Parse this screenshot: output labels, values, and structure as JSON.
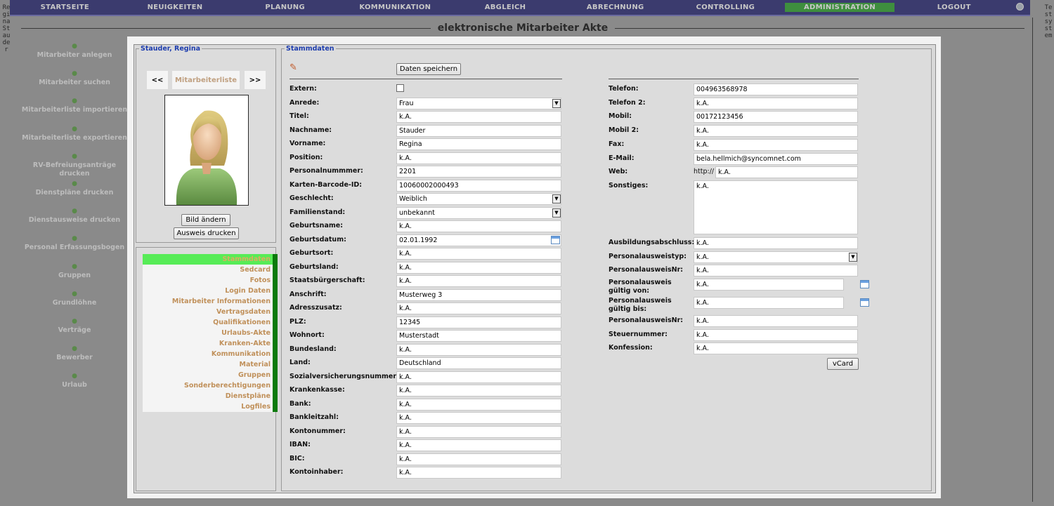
{
  "nav": {
    "items": [
      "STARTSEITE",
      "NEUIGKEITEN",
      "PLANUNG",
      "KOMMUNIKATION",
      "ABGLEICH",
      "ABRECHNUNG",
      "CONTROLLING",
      "ADMINISTRATION",
      "LOGOUT"
    ],
    "active": "ADMINISTRATION",
    "user_icon": "user-icon"
  },
  "side_left_text": "Regina Stauder",
  "side_right_text": "Testsystem",
  "page_title": "elektronische Mitarbeiter Akte",
  "left_menu": [
    {
      "label": "Mitarbeiter anlegen",
      "icon": "user-add-icon"
    },
    {
      "label": "Mitarbeiter suchen",
      "icon": "user-search-icon"
    },
    {
      "label": "Mitarbeiterliste importieren",
      "icon": "import-icon"
    },
    {
      "label": "Mitarbeiterliste exportieren",
      "icon": "export-icon"
    },
    {
      "label": "RV-Befreiungsanträge drucken",
      "icon": "pdf-icon"
    },
    {
      "label": "Dienstpläne drucken",
      "icon": "user-print-icon"
    },
    {
      "label": "Dienstausweise drucken",
      "icon": "id-card-icon"
    },
    {
      "label": "Personal Erfassungsbogen",
      "icon": "form-icon"
    },
    {
      "label": "Gruppen",
      "icon": "group-icon"
    },
    {
      "label": "Grundlöhne",
      "icon": "wage-icon"
    },
    {
      "label": "Verträge",
      "icon": "contract-icon"
    },
    {
      "label": "Bewerber",
      "icon": "applicant-icon"
    },
    {
      "label": "Urlaub",
      "icon": "vacation-icon"
    }
  ],
  "person": {
    "legend": "Stauder, Regina",
    "prev": "<<",
    "next": ">>",
    "list_button": "Mitarbeiterliste",
    "change_picture": "Bild ändern",
    "print_id": "Ausweis drucken"
  },
  "subnav": {
    "items": [
      "Stammdaten",
      "Sedcard",
      "Fotos",
      "Login Daten",
      "Mitarbeiter Informationen",
      "Vertragsdaten",
      "Qualifikationen",
      "Urlaubs-Akte",
      "Kranken-Akte",
      "Kommunikation",
      "Material",
      "Gruppen",
      "Sonderberechtigungen",
      "Dienstpläne",
      "Logfiles"
    ],
    "active": "Stammdaten"
  },
  "stamm": {
    "legend": "Stammdaten",
    "save_button": "Daten speichern",
    "vcard_button": "vCard",
    "left_fields": [
      {
        "label": "Extern:",
        "type": "checkbox",
        "value": ""
      },
      {
        "label": "Anrede:",
        "type": "select",
        "value": "Frau"
      },
      {
        "label": "Titel:",
        "type": "text",
        "value": "k.A."
      },
      {
        "label": "Nachname:",
        "type": "text",
        "value": "Stauder"
      },
      {
        "label": "Vorname:",
        "type": "text",
        "value": "Regina"
      },
      {
        "label": "Position:",
        "type": "text",
        "value": "k.A."
      },
      {
        "label": "Personalnummmer:",
        "type": "text",
        "value": "2201"
      },
      {
        "label": "Karten-Barcode-ID:",
        "type": "text",
        "value": "10060002000493"
      },
      {
        "label": "Geschlecht:",
        "type": "select",
        "value": "Weiblich"
      },
      {
        "label": "Familienstand:",
        "type": "select",
        "value": "unbekannt"
      },
      {
        "label": "Geburtsname:",
        "type": "text",
        "value": "k.A."
      },
      {
        "label": "Geburtsdatum:",
        "type": "date",
        "value": "02.01.1992"
      },
      {
        "label": "Geburtsort:",
        "type": "text",
        "value": "k.A."
      },
      {
        "label": "Geburtsland:",
        "type": "text",
        "value": "k.A."
      },
      {
        "label": "Staatsbürgerschaft:",
        "type": "text",
        "value": "k.A."
      },
      {
        "label": "Anschrift:",
        "type": "text",
        "value": "Musterweg 3"
      },
      {
        "label": "Adresszusatz:",
        "type": "text",
        "value": "k.A."
      },
      {
        "label": "PLZ:",
        "type": "text",
        "value": "12345"
      },
      {
        "label": "Wohnort:",
        "type": "text",
        "value": "Musterstadt"
      },
      {
        "label": "Bundesland:",
        "type": "text",
        "value": "k.A."
      },
      {
        "label": "Land:",
        "type": "text",
        "value": "Deutschland"
      },
      {
        "label": "Sozialversicherungsnummer:",
        "type": "text",
        "value": "k.A."
      },
      {
        "label": "Krankenkasse:",
        "type": "text",
        "value": "k.A."
      },
      {
        "label": "Bank:",
        "type": "text",
        "value": "k.A."
      },
      {
        "label": "Bankleitzahl:",
        "type": "text",
        "value": "k.A."
      },
      {
        "label": "Kontonummer:",
        "type": "text",
        "value": "k.A."
      },
      {
        "label": "IBAN:",
        "type": "text",
        "value": "k.A."
      },
      {
        "label": "BIC:",
        "type": "text",
        "value": "k.A."
      },
      {
        "label": "Kontoinhaber:",
        "type": "text",
        "value": "k.A."
      }
    ],
    "right_fields": [
      {
        "label": "Telefon:",
        "type": "text",
        "value": "004963568978"
      },
      {
        "label": "Telefon 2:",
        "type": "text",
        "value": "k.A."
      },
      {
        "label": "Mobil:",
        "type": "text",
        "value": "00172123456"
      },
      {
        "label": "Mobil 2:",
        "type": "text",
        "value": "k.A."
      },
      {
        "label": "Fax:",
        "type": "text",
        "value": "k.A."
      },
      {
        "label": "E-Mail:",
        "type": "text",
        "value": "bela.hellmich@syncomnet.com"
      },
      {
        "label": "Web:",
        "type": "web",
        "prefix": "http://",
        "value": "k.A."
      },
      {
        "label": "Sonstiges:",
        "type": "textarea",
        "value": "k.A."
      },
      {
        "label": "Ausbildungsabschluss:",
        "type": "text",
        "value": "k.A."
      },
      {
        "label": "Personalausweistyp:",
        "type": "select",
        "value": "k.A."
      },
      {
        "label": "PersonalausweisNr:",
        "type": "text",
        "value": "k.A."
      },
      {
        "label": "Personalausweis gültig von:",
        "type": "date2",
        "value": "k.A."
      },
      {
        "label": "Personalausweis gültig bis:",
        "type": "date2",
        "value": "k.A."
      },
      {
        "label": "PersonalausweisNr:",
        "type": "text",
        "value": "k.A."
      },
      {
        "label": "Steuernummer:",
        "type": "text",
        "value": "k.A."
      },
      {
        "label": "Konfession:",
        "type": "text",
        "value": "k.A."
      }
    ]
  }
}
